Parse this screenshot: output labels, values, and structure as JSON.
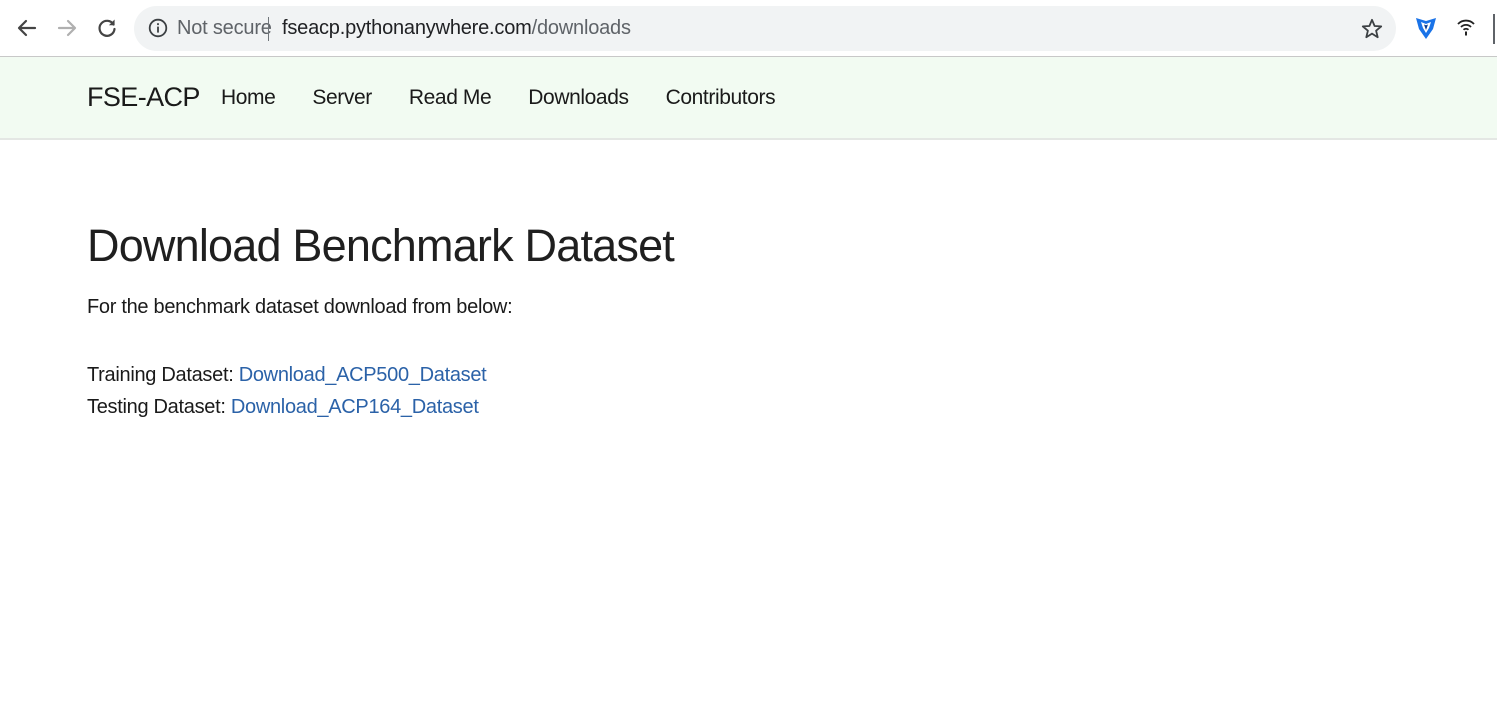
{
  "browser": {
    "security_label": "Not secure",
    "url_host": "fseacp.pythonanywhere.com",
    "url_path": "/downloads",
    "icons": {
      "back": "arrow-left-icon",
      "forward": "arrow-right-icon",
      "reload": "reload-icon",
      "info": "info-icon",
      "bookmark": "star-icon",
      "extension_1": "shield-extension-icon",
      "extension_2": "wifi-extension-icon"
    }
  },
  "site": {
    "brand": "FSE-ACP",
    "nav": [
      "Home",
      "Server",
      "Read Me",
      "Downloads",
      "Contributors"
    ]
  },
  "main": {
    "title": "Download Benchmark Dataset",
    "intro": "For the benchmark dataset download from below:",
    "downloads": [
      {
        "label": "Training Dataset:",
        "link": "Download_ACP500_Dataset"
      },
      {
        "label": "Testing Dataset:",
        "link": "Download_ACP164_Dataset"
      }
    ]
  },
  "colors": {
    "navbar_bg": "#f2fbf2",
    "link": "#2b62a8",
    "omnibox_bg": "#f1f3f4"
  }
}
